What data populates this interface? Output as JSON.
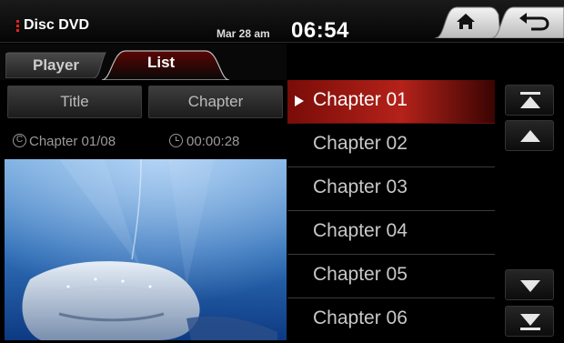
{
  "header": {
    "source": "Disc DVD",
    "date": "Mar 28 am",
    "time": "06:54"
  },
  "tabs": [
    {
      "label": "Player",
      "active": false
    },
    {
      "label": "List",
      "active": true
    }
  ],
  "mode_buttons": {
    "title": "Title",
    "chapter": "Chapter"
  },
  "status": {
    "chapter": "Chapter 01/08",
    "time": "00:00:28"
  },
  "chapters": [
    {
      "label": "Chapter 01",
      "selected": true
    },
    {
      "label": "Chapter 02",
      "selected": false
    },
    {
      "label": "Chapter 03",
      "selected": false
    },
    {
      "label": "Chapter 04",
      "selected": false
    },
    {
      "label": "Chapter 05",
      "selected": false
    },
    {
      "label": "Chapter 06",
      "selected": false
    }
  ],
  "icons": {
    "home": "home-icon",
    "back": "back-arrow-icon",
    "scroll_top": "skip-to-top-icon",
    "scroll_up": "page-up-icon",
    "scroll_down": "page-down-icon",
    "scroll_bottom": "skip-to-bottom-icon",
    "chapter": "copyright-icon",
    "time": "clock-icon"
  },
  "colors": {
    "accent": "#b4221a",
    "background": "#000000"
  }
}
